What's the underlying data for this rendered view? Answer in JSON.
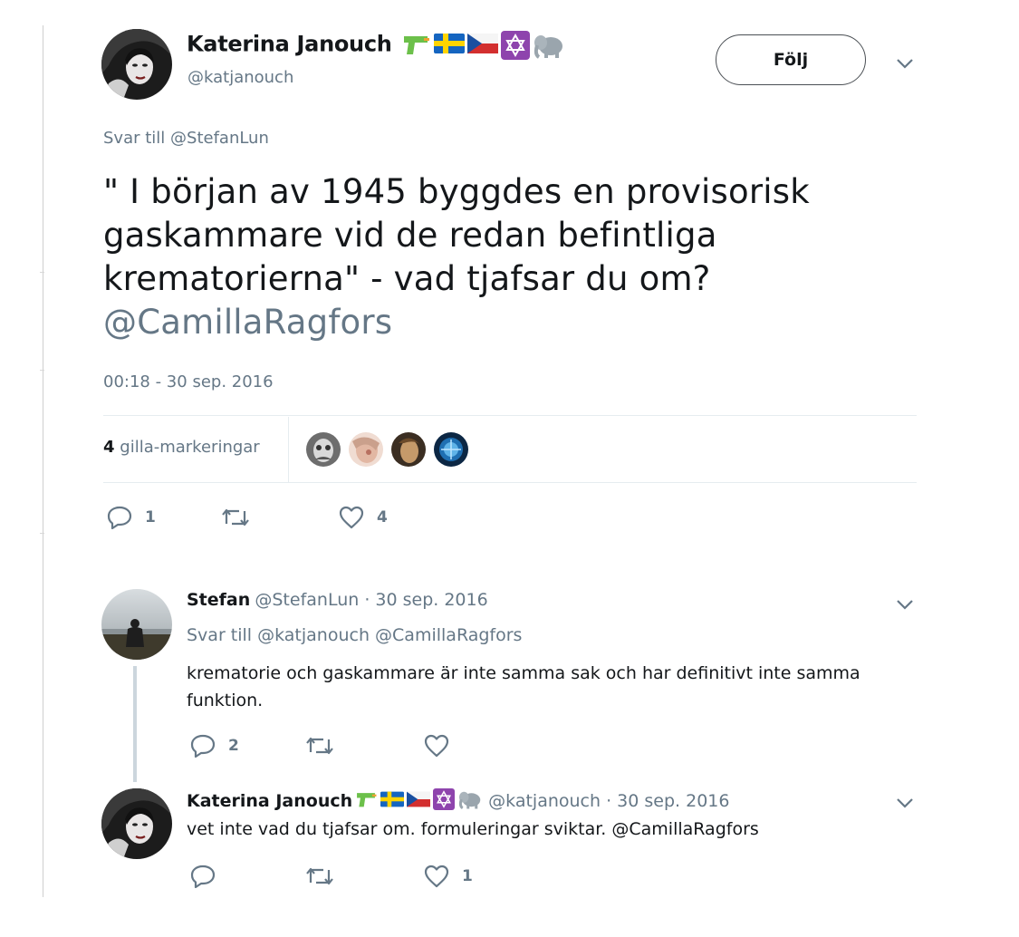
{
  "main_tweet": {
    "name": "Katerina Janouch",
    "handle": "@katjanouch",
    "name_emoji": [
      "water-pistol",
      "flag-sweden",
      "flag-czech",
      "star-of-david",
      "elephant"
    ],
    "follow_label": "Följ",
    "reply_to": "Svar till @StefanLun",
    "text_lines": [
      "\" I början av 1945 byggdes en provisorisk",
      "gaskammare vid de redan befintliga",
      "krematorierna\" - vad tjafsar du om?"
    ],
    "mention": "@CamillaRagfors",
    "timestamp": "00:18 - 30 sep. 2016",
    "likes_number": "4",
    "likes_label": "gilla-markeringar",
    "actions": {
      "reply_count": "1",
      "retweet_count": "",
      "like_count": "4"
    }
  },
  "replies": [
    {
      "name": "Stefan",
      "meta": "@StefanLun · 30 sep. 2016",
      "reply_to": "Svar till @katjanouch @CamillaRagfors",
      "text_lines": [
        "krematorie och gaskammare är inte samma sak och har definitivt inte samma",
        "funktion."
      ],
      "actions": {
        "reply_count": "2",
        "retweet_count": "",
        "like_count": ""
      }
    },
    {
      "name": "Katerina Janouch",
      "meta": "@katjanouch · 30 sep. 2016",
      "text": "vet inte vad du tjafsar om. formuleringar sviktar. @CamillaRagfors",
      "actions": {
        "reply_count": "",
        "retweet_count": "",
        "like_count": "1"
      }
    }
  ],
  "colors": {
    "muted": "#657786",
    "text": "#14171a",
    "divider": "#e6ecf0",
    "thread_line": "#ccd6dd"
  }
}
